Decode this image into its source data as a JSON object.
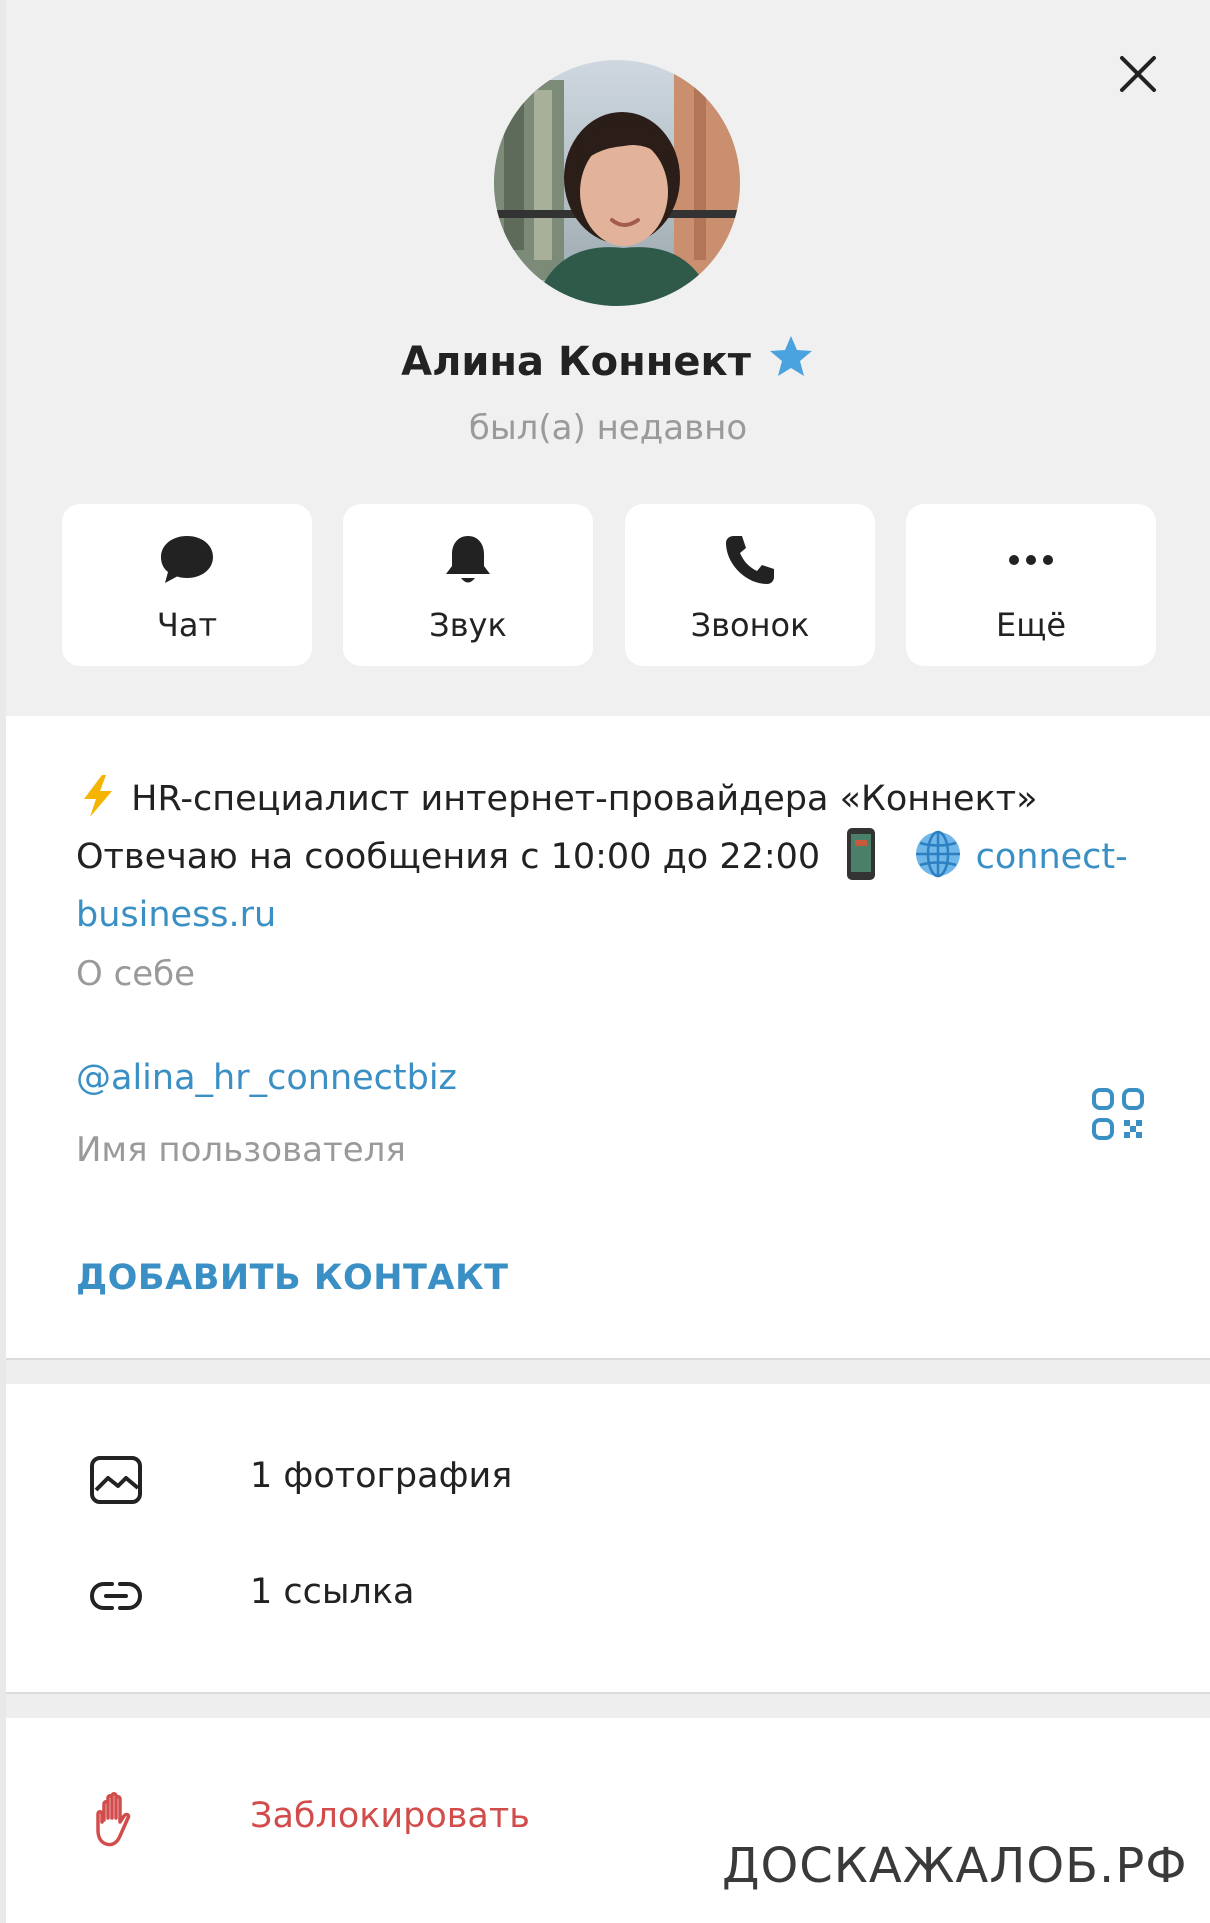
{
  "profile": {
    "name": "Алина Коннект",
    "status": "был(а) недавно",
    "premium_icon": "star-icon"
  },
  "actions": [
    {
      "label": "Чат",
      "icon": "chat-bubble-icon"
    },
    {
      "label": "Звук",
      "icon": "bell-icon"
    },
    {
      "label": "Звонок",
      "icon": "phone-icon"
    },
    {
      "label": "Ещё",
      "icon": "more-dots-icon"
    }
  ],
  "bio": {
    "line1": "HR-специалист интернет-провайдера «Коннект»",
    "line2": "Отвечаю на сообщения с 10:00 до 22:00",
    "link_part1": "connect-",
    "link_part2": "business.ru",
    "caption": "О себе"
  },
  "username": {
    "value": "@alina_hr_connectbiz",
    "caption": "Имя пользователя"
  },
  "add_contact_label": "ДОБАВИТЬ КОНТАКТ",
  "media": [
    {
      "label": "1 фотография",
      "icon": "photo-icon"
    },
    {
      "label": "1 ссылка",
      "icon": "link-icon"
    }
  ],
  "block_label": "Заблокировать",
  "watermark": "ДОСКАЖАЛОБ.РФ",
  "colors": {
    "accent": "#3a8fc4",
    "danger": "#d24c4c",
    "muted": "#9a9a9a",
    "header_bg": "#f0f0f0"
  }
}
